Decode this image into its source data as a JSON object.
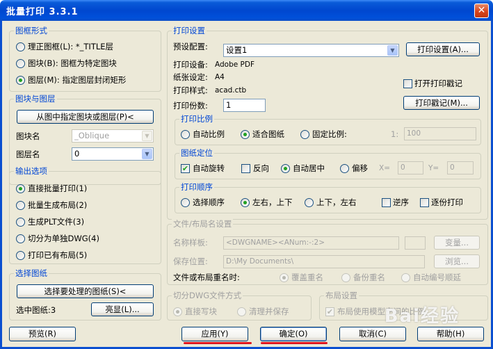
{
  "window": {
    "title": "批量打印 3.3.1",
    "close_icon": "close-icon"
  },
  "frame_form": {
    "title": "图框形式",
    "options": [
      {
        "label": "理正图框(L): *_TITLE层",
        "selected": false
      },
      {
        "label": "图块(B): 图框为特定图块",
        "selected": false
      },
      {
        "label": "图层(M): 指定图层封闭矩形",
        "selected": true
      }
    ]
  },
  "block_layer": {
    "title": "图块与图层",
    "pick_button": "从图中指定图块或图层(P)<",
    "block_label": "图块名",
    "block_value": "_Oblique",
    "layer_label": "图层名",
    "layer_value": "0"
  },
  "output": {
    "title": "输出选项",
    "options": [
      {
        "label": "直接批量打印(1)",
        "selected": true
      },
      {
        "label": "批量生成布局(2)",
        "selected": false
      },
      {
        "label": "生成PLT文件(3)",
        "selected": false
      },
      {
        "label": "切分为单独DWG(4)",
        "selected": false
      },
      {
        "label": "打印已有布局(5)",
        "selected": false
      }
    ]
  },
  "select_drawing": {
    "title": "选择图纸",
    "select_button": "选择要处理的图纸(S)<",
    "selected_label": "选中图纸:3",
    "highlight_button": "亮显(L)..."
  },
  "print_settings": {
    "title": "打印设置",
    "preset_label": "预设配置:",
    "preset_value": "设置1",
    "setup_button": "打印设置(A)...",
    "device_label": "打印设备:",
    "device_value": "Adobe PDF",
    "paper_label": "纸张设定:",
    "paper_value": "A4",
    "style_label": "打印样式:",
    "style_value": "acad.ctb",
    "open_stamp_label": "打开打印戳记",
    "open_stamp_checked": false,
    "stamp_button": "打印戳记(M)...",
    "copies_label": "打印份数:",
    "copies_value": "1"
  },
  "print_scale": {
    "title": "打印比例",
    "options": [
      {
        "label": "自动比例",
        "selected": false
      },
      {
        "label": "适合图纸",
        "selected": true
      },
      {
        "label": "固定比例:",
        "selected": false
      }
    ],
    "ratio_prefix": "1:",
    "ratio_value": "100"
  },
  "positioning": {
    "title": "图纸定位",
    "auto_rotate_label": "自动旋转",
    "auto_rotate_checked": true,
    "reverse_label": "反向",
    "reverse_checked": false,
    "center_label": "自动居中",
    "center_selected": true,
    "offset_label": "偏移",
    "offset_selected": false,
    "x_label": "X=",
    "x_value": "0",
    "y_label": "Y=",
    "y_value": "0"
  },
  "print_order": {
    "title": "打印顺序",
    "options": [
      {
        "label": "选择顺序",
        "selected": false
      },
      {
        "label": "左右，上下",
        "selected": true
      },
      {
        "label": "上下，左右",
        "selected": false
      }
    ],
    "reverse_label": "逆序",
    "reverse_checked": false,
    "one_by_one_label": "逐份打印",
    "one_by_one_checked": false
  },
  "file_layout": {
    "title": "文件/布局名设置",
    "template_label": "名称样板:",
    "template_value": "<DWGNAME><ANum:-:2>",
    "variable_button": "变量...",
    "save_label": "保存位置:",
    "save_value": "D:\\My Documents\\",
    "browse_button": "浏览...",
    "rename_label": "文件或布局重名时:",
    "rename_options": [
      {
        "label": "覆盖重名",
        "selected": true
      },
      {
        "label": "备份重名",
        "selected": false
      },
      {
        "label": "自动编号顺延",
        "selected": false
      }
    ]
  },
  "split_dwg": {
    "title": "切分DWG文件方式",
    "options": [
      {
        "label": "直接写块",
        "selected": true
      },
      {
        "label": "清理并保存",
        "selected": false
      }
    ]
  },
  "layout_settings": {
    "title": "布局设置",
    "use_model_label": "布局使用模型空间的比例",
    "use_model_checked": true
  },
  "footer": {
    "preview_button": "预览(R)",
    "apply_button": "应用(Y)",
    "ok_button": "确定(O)",
    "cancel_button": "取消(C)",
    "help_button": "帮助(H)"
  },
  "watermark": "Bai经验",
  "colors": {
    "group_title": "#0046d5",
    "titlebar": "#0047cf",
    "annotation": "#e0161e",
    "radio_dot": "#21a121"
  }
}
